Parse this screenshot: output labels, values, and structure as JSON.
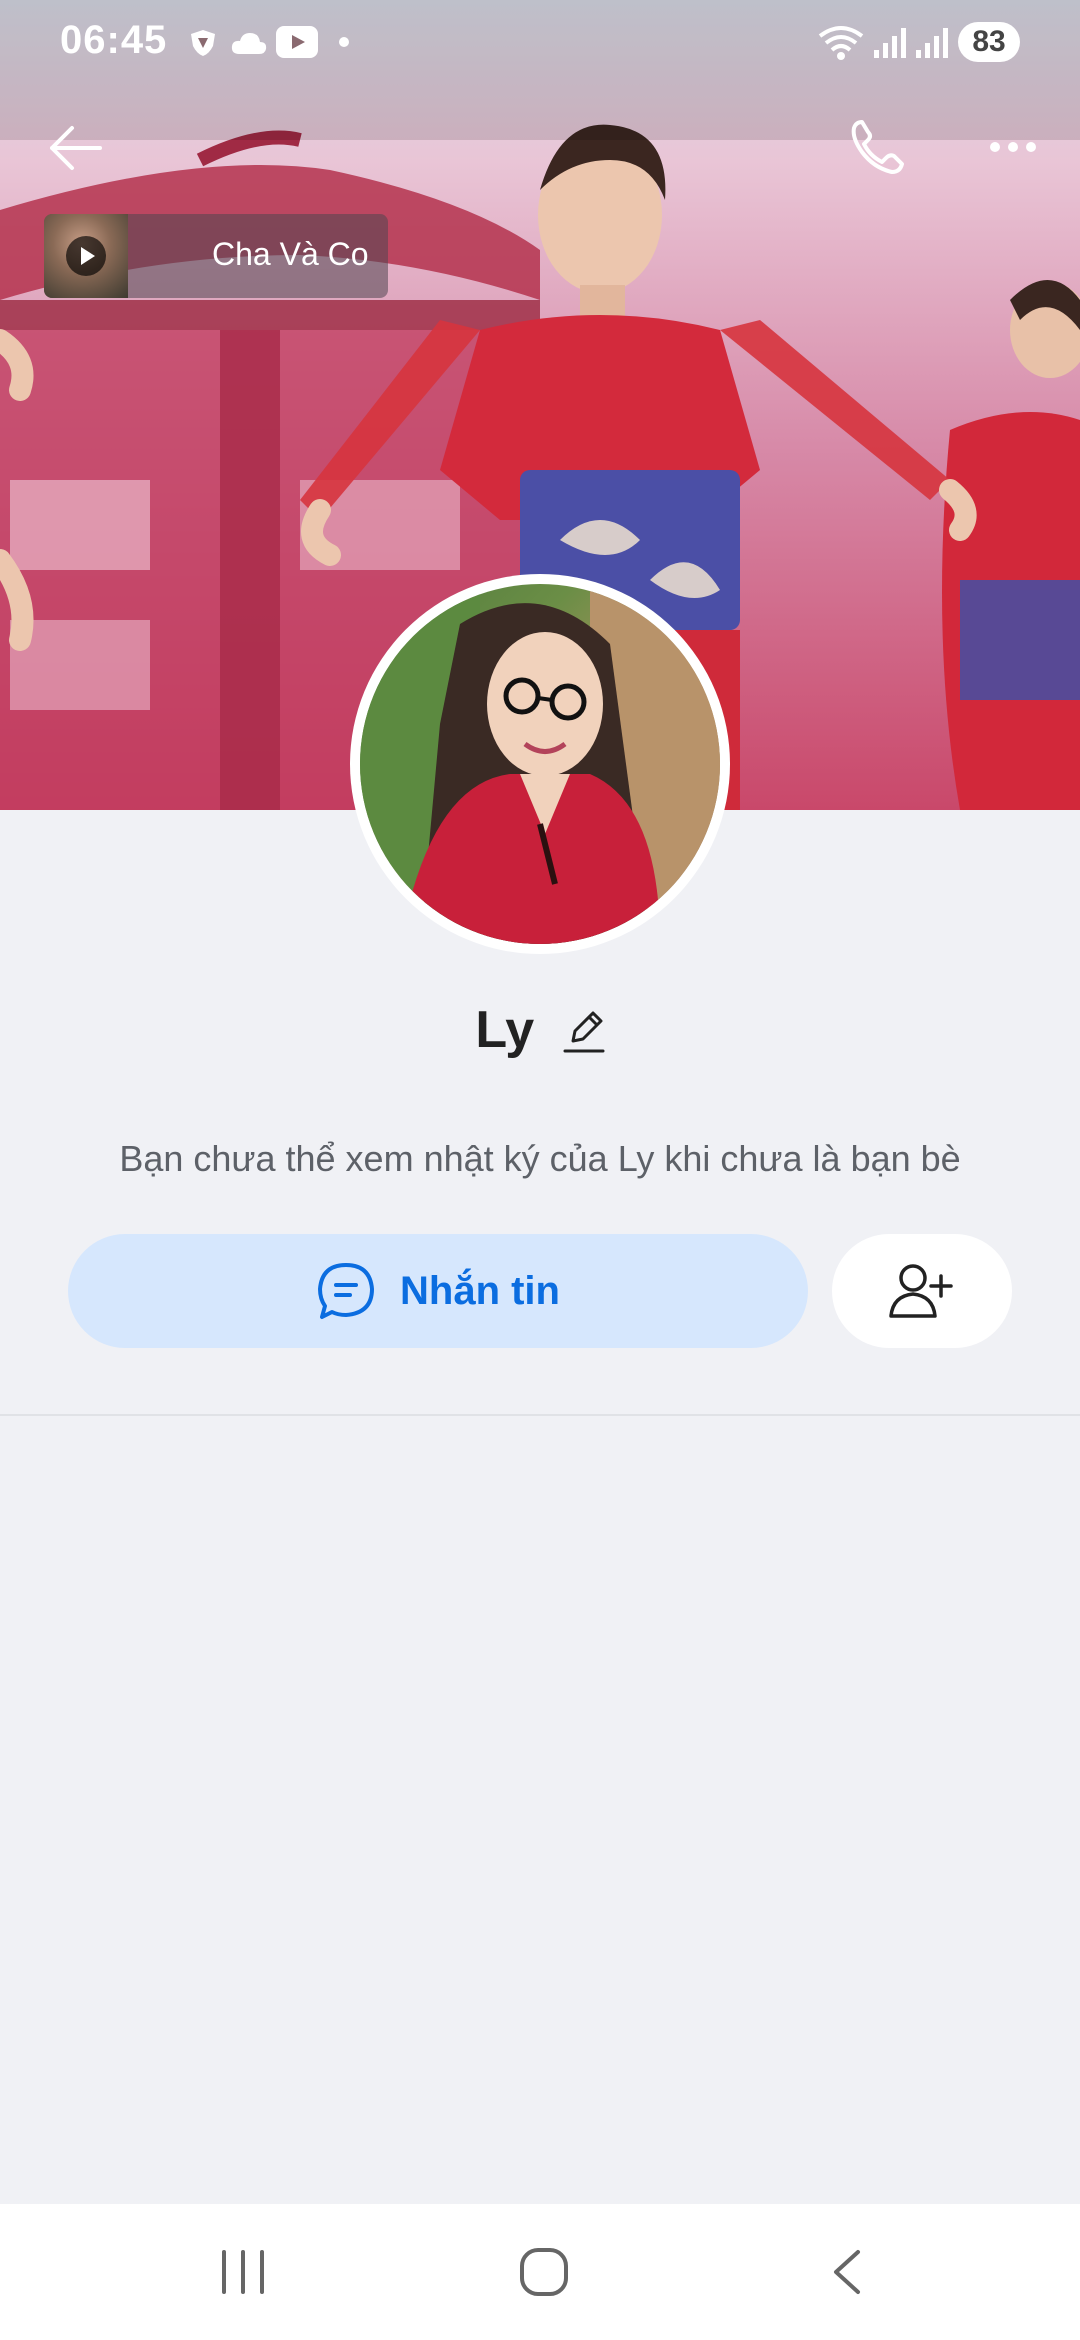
{
  "status_bar": {
    "time": "06:45",
    "battery": "83",
    "icons": [
      "shield-icon",
      "cloud-icon",
      "youtube-icon",
      "dot-icon",
      "wifi-icon",
      "signal-icon",
      "signal-icon"
    ]
  },
  "topbar": {
    "icons": [
      "back-arrow-icon",
      "phone-icon",
      "more-icon"
    ]
  },
  "music": {
    "title": "Cha Và Co",
    "icon": "play-icon"
  },
  "profile": {
    "name": "Ly",
    "diary_notice": "Bạn chưa thể xem nhật ký của Ly khi chưa là bạn bè"
  },
  "actions": {
    "message_label": "Nhắn tin",
    "message_icon": "chat-bubble-icon",
    "add_friend_icon": "add-friend-icon"
  },
  "nav": {
    "icons": [
      "recents-icon",
      "home-icon",
      "back-icon"
    ]
  },
  "colors": {
    "accent": "#0b6de0",
    "message_button_bg": "#d6e7fd",
    "page_bg": "#f0f1f5"
  }
}
